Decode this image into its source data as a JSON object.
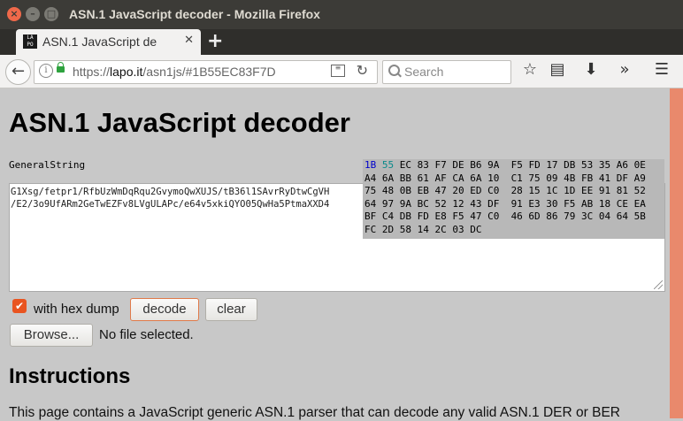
{
  "window": {
    "title": "ASN.1 JavaScript decoder - Mozilla Firefox"
  },
  "tab": {
    "title": "ASN.1 JavaScript de",
    "favicon_text": "LA PO"
  },
  "nav": {
    "url_prefix": "https://",
    "url_host": "lapo.it",
    "url_rest": "/asn1js/#1B55EC83F7D",
    "search_placeholder": "Search"
  },
  "icons": {
    "back": "arrow-left-icon",
    "info": "info-icon",
    "lock": "lock-icon",
    "reader": "reader-view-icon",
    "reload": "reload-icon",
    "bookmark": "star-icon",
    "library": "library-icon",
    "download": "download-icon",
    "overflow": "chevron-right-double-icon",
    "menu": "hamburger-menu-icon"
  },
  "page": {
    "title": "ASN.1 JavaScript decoder",
    "tree_label": "GeneralString",
    "textarea_lines": [
      "G1Xsg/fetpr1/RfbUzWmDqRqu2GvymoQwXUJS/tB36l1SAvrRyDtwCgVH",
      "/E2/3o9UfARm2GeTwEZFv8LVgULAPc/e64v5xkiQYO05QwHa5PtmaXXD4"
    ],
    "hexdump": {
      "first_row": [
        "1B",
        "55",
        "EC 83 F7 DE B6 9A  F5 FD 17 DB 53 35 A6 0E"
      ],
      "rows": [
        "A4 6A BB 61 AF CA 6A 10  C1 75 09 4B FB 41 DF A9",
        "75 48 0B EB 47 20 ED C0  28 15 1C 1D EE 91 81 52",
        "64 97 9A BC 52 12 43 DF  91 E3 30 F5 AB 18 CE EA",
        "BF C4 DB FD E8 F5 47 C0  46 6D 86 79 3C 04 64 5B",
        "FC 2D 58 14 2C 03 DC"
      ]
    },
    "hex_checkbox_checked": true,
    "hex_checkbox_label": "with hex dump",
    "decode_label": "decode",
    "clear_label": "clear",
    "browse_label": "Browse...",
    "no_file_label": "No file selected.",
    "instructions_heading": "Instructions",
    "instructions_text": "This page contains a JavaScript generic ASN.1 parser that can decode any valid ASN.1 DER or BER"
  },
  "colors": {
    "accent": "#e95420",
    "page_bg": "#c8c8c8",
    "hex_highlight": "#0000cc"
  }
}
